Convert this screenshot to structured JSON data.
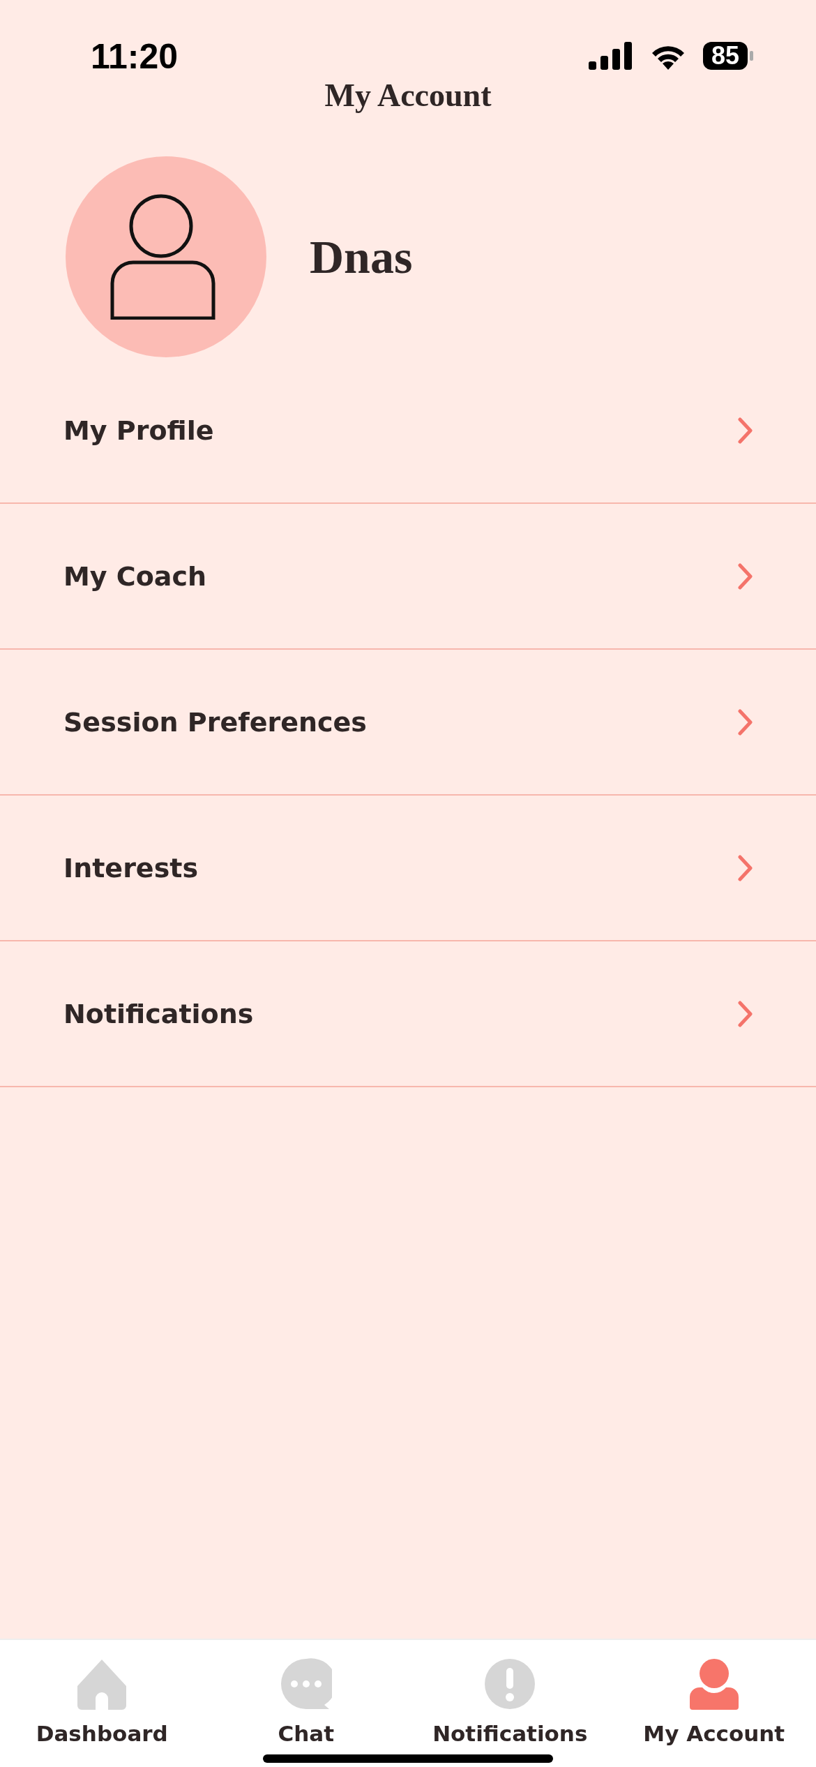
{
  "status_bar": {
    "time": "11:20",
    "battery": "85"
  },
  "header": {
    "title": "My Account"
  },
  "profile": {
    "name": "Dnas"
  },
  "menu": [
    {
      "label": "My Profile"
    },
    {
      "label": "My Coach"
    },
    {
      "label": "Session Preferences"
    },
    {
      "label": "Interests"
    },
    {
      "label": "Notifications"
    }
  ],
  "tab_bar": [
    {
      "kind": "home",
      "label": "Dashboard",
      "selected": false
    },
    {
      "kind": "chat",
      "label": "Chat",
      "selected": false
    },
    {
      "kind": "alert",
      "label": "Notifications",
      "selected": false
    },
    {
      "kind": "person",
      "label": "My Account",
      "selected": true
    }
  ]
}
